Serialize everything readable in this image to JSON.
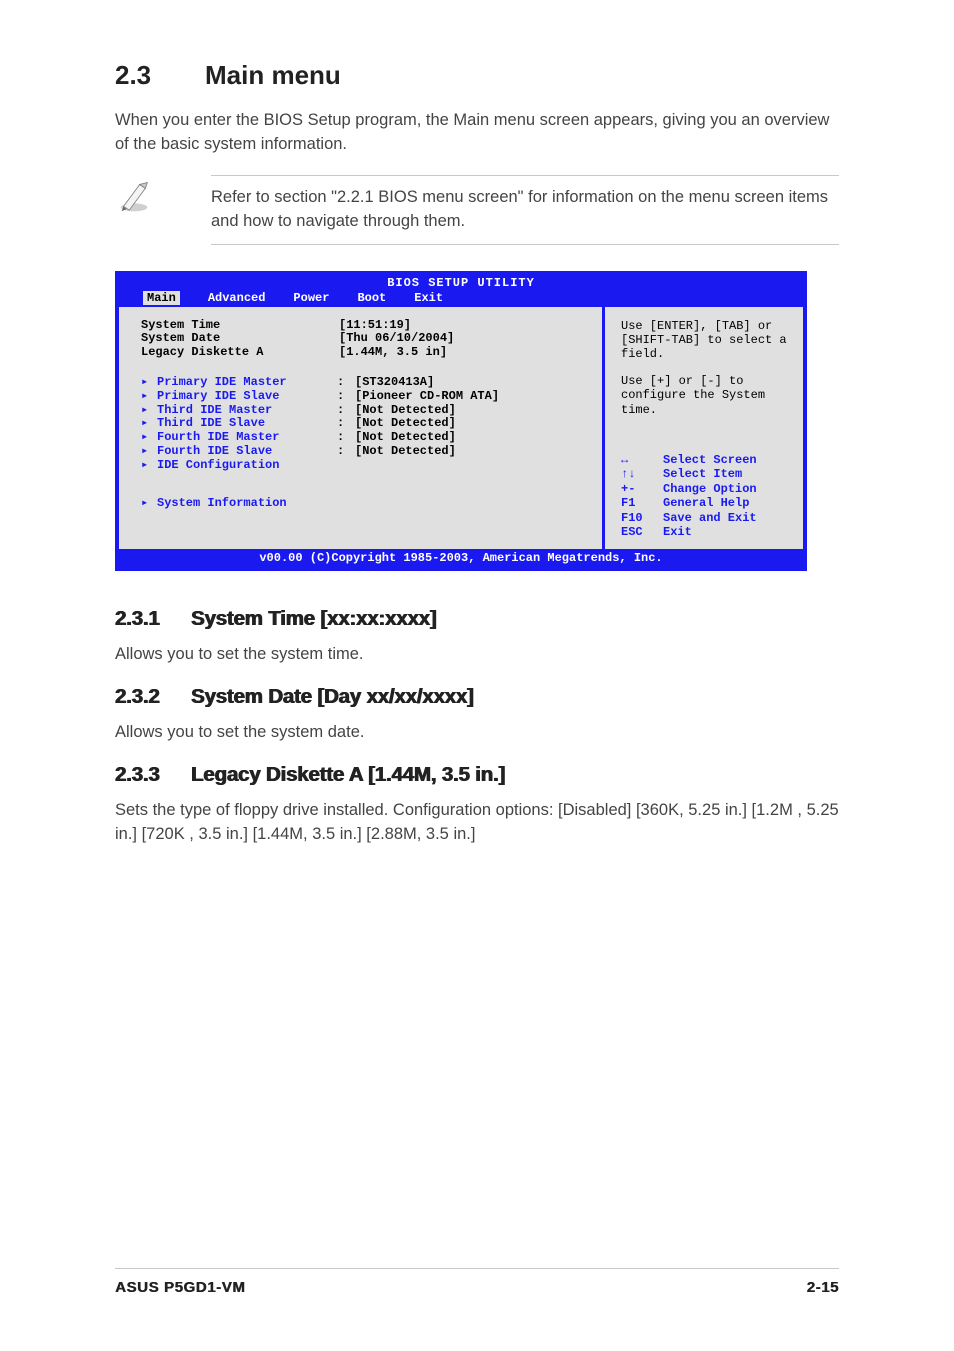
{
  "section": {
    "number": "2.3",
    "title": "Main menu"
  },
  "intro_para": "When you enter the BIOS Setup program, the Main menu screen appears, giving you an overview of the basic system information.",
  "note": "Refer to section \"2.2.1 BIOS menu screen\" for information on the menu screen items and how to navigate through them.",
  "bios": {
    "title": "BIOS SETUP UTILITY",
    "menubar": [
      {
        "label": "Main",
        "active": true
      },
      {
        "label": "Advanced",
        "active": false
      },
      {
        "label": "Power",
        "active": false
      },
      {
        "label": "Boot",
        "active": false
      },
      {
        "label": "Exit",
        "active": false
      }
    ],
    "rows_top": [
      {
        "label": "System Time",
        "value": "[11:51:19]"
      },
      {
        "label": "System Date",
        "value": "[Thu 06/10/2004]"
      },
      {
        "label": "Legacy Diskette A",
        "value": "[1.44M, 3.5 in]"
      }
    ],
    "rows_ide": [
      {
        "label": "Primary IDE Master",
        "value": "[ST320413A]"
      },
      {
        "label": "Primary IDE Slave",
        "value": "[Pioneer CD-ROM ATA]"
      },
      {
        "label": "Third IDE Master",
        "value": "[Not Detected]"
      },
      {
        "label": "Third IDE Slave",
        "value": "[Not Detected]"
      },
      {
        "label": "Fourth IDE Master",
        "value": "[Not Detected]"
      },
      {
        "label": "Fourth IDE Slave",
        "value": "[Not Detected]"
      },
      {
        "label": "IDE Configuration",
        "value": ""
      }
    ],
    "sysinfo_label": "System Information",
    "help1": "Use [ENTER], [TAB] or [SHIFT-TAB] to select a field.",
    "help2": "Use [+] or [-] to configure the System time.",
    "legend": [
      {
        "key": "↔",
        "desc": "Select Screen"
      },
      {
        "key": "↑↓",
        "desc": "Select Item"
      },
      {
        "key": "+-",
        "desc": "Change Option"
      },
      {
        "key": "F1",
        "desc": "General Help"
      },
      {
        "key": "F10",
        "desc": "Save and Exit"
      },
      {
        "key": "ESC",
        "desc": "Exit"
      }
    ],
    "footer": "v00.00 (C)Copyright 1985-2003, American Megatrends, Inc."
  },
  "subs": [
    {
      "num": "2.3.1",
      "title": "System Time [xx:xx:xxxx]",
      "body": "Allows you to set the system time."
    },
    {
      "num": "2.3.2",
      "title": "System Date [Day xx/xx/xxxx]",
      "body": "Allows you to set the system date."
    },
    {
      "num": "2.3.3",
      "title": "Legacy Diskette A [1.44M, 3.5 in.]",
      "body": "Sets the type of floppy drive installed. Configuration options: [Disabled] [360K, 5.25 in.] [1.2M , 5.25 in.] [720K , 3.5 in.] [1.44M, 3.5 in.] [2.88M, 3.5 in.]"
    }
  ],
  "footer": {
    "left": "ASUS P5GD1-VM",
    "right": "2-15"
  }
}
